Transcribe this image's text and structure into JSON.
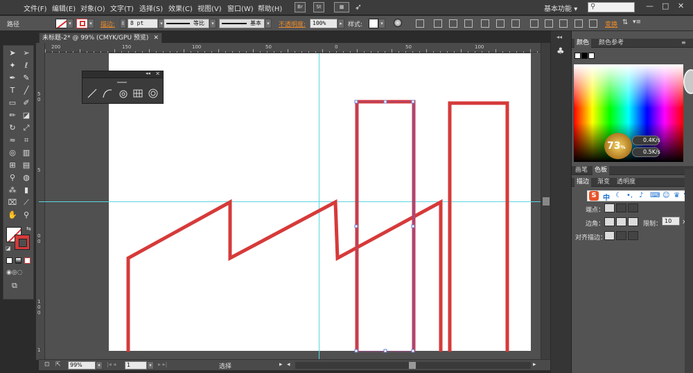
{
  "menu": {
    "items": [
      "文件(F)",
      "编辑(E)",
      "对象(O)",
      "文字(T)",
      "选择(S)",
      "效果(C)",
      "视图(V)",
      "窗口(W)",
      "帮助(H)"
    ],
    "bridge_icon": "Br",
    "stock_icon": "St",
    "workspace": "基本功能",
    "workspace_arrow": "▾",
    "search_placeholder": "",
    "minimize": "—",
    "restore": "□",
    "close": "✕"
  },
  "control": {
    "path_label": "路径",
    "stroke_label": "描边",
    "stroke_value": "8 pt",
    "profile_label": "等比",
    "brush_label": "基本",
    "opacity_label": "不透明度",
    "opacity_value": "100%",
    "style_label": "样式",
    "transform_label": "变换",
    "colon": ":"
  },
  "document": {
    "tab_title": "未标题-2* @ 99% (CMYK/GPU 预览)",
    "tab_close": "✕"
  },
  "rulers": {
    "top": [
      "200",
      "150",
      "100",
      "50",
      "0",
      "50",
      "100"
    ],
    "left": [
      "5",
      "0",
      "5",
      "0",
      "0",
      "5",
      "0",
      "1",
      "0",
      "0",
      "1",
      "5",
      "0"
    ]
  },
  "status": {
    "zoom": "99%",
    "artboard": "1",
    "tool": "选择"
  },
  "panels": {
    "color_tab": "颜色",
    "color_guide_tab": "颜色参考",
    "brushes_tab": "画笔",
    "swatches_tab": "色板",
    "stroke_tab": "描边",
    "gradient_tab": "渐变",
    "transparency_tab": "透明度",
    "cap_label": "端点：",
    "corner_label": "边角：",
    "limit_label": "限制：",
    "limit_value": "10",
    "limit_unit": "x",
    "align_label": "对齐描边："
  },
  "speed_widget": {
    "number": "73",
    "unit": "%",
    "up": "0.4K/s",
    "down": "0.5K/s"
  },
  "ime": {
    "logo": "S",
    "lang": "中"
  },
  "colors": {
    "stroke_red": "#d63a3a",
    "selection_purple": "#9b4a8c",
    "guide_cyan": "#5ad6e0",
    "accent_orange": "#f08c28"
  }
}
